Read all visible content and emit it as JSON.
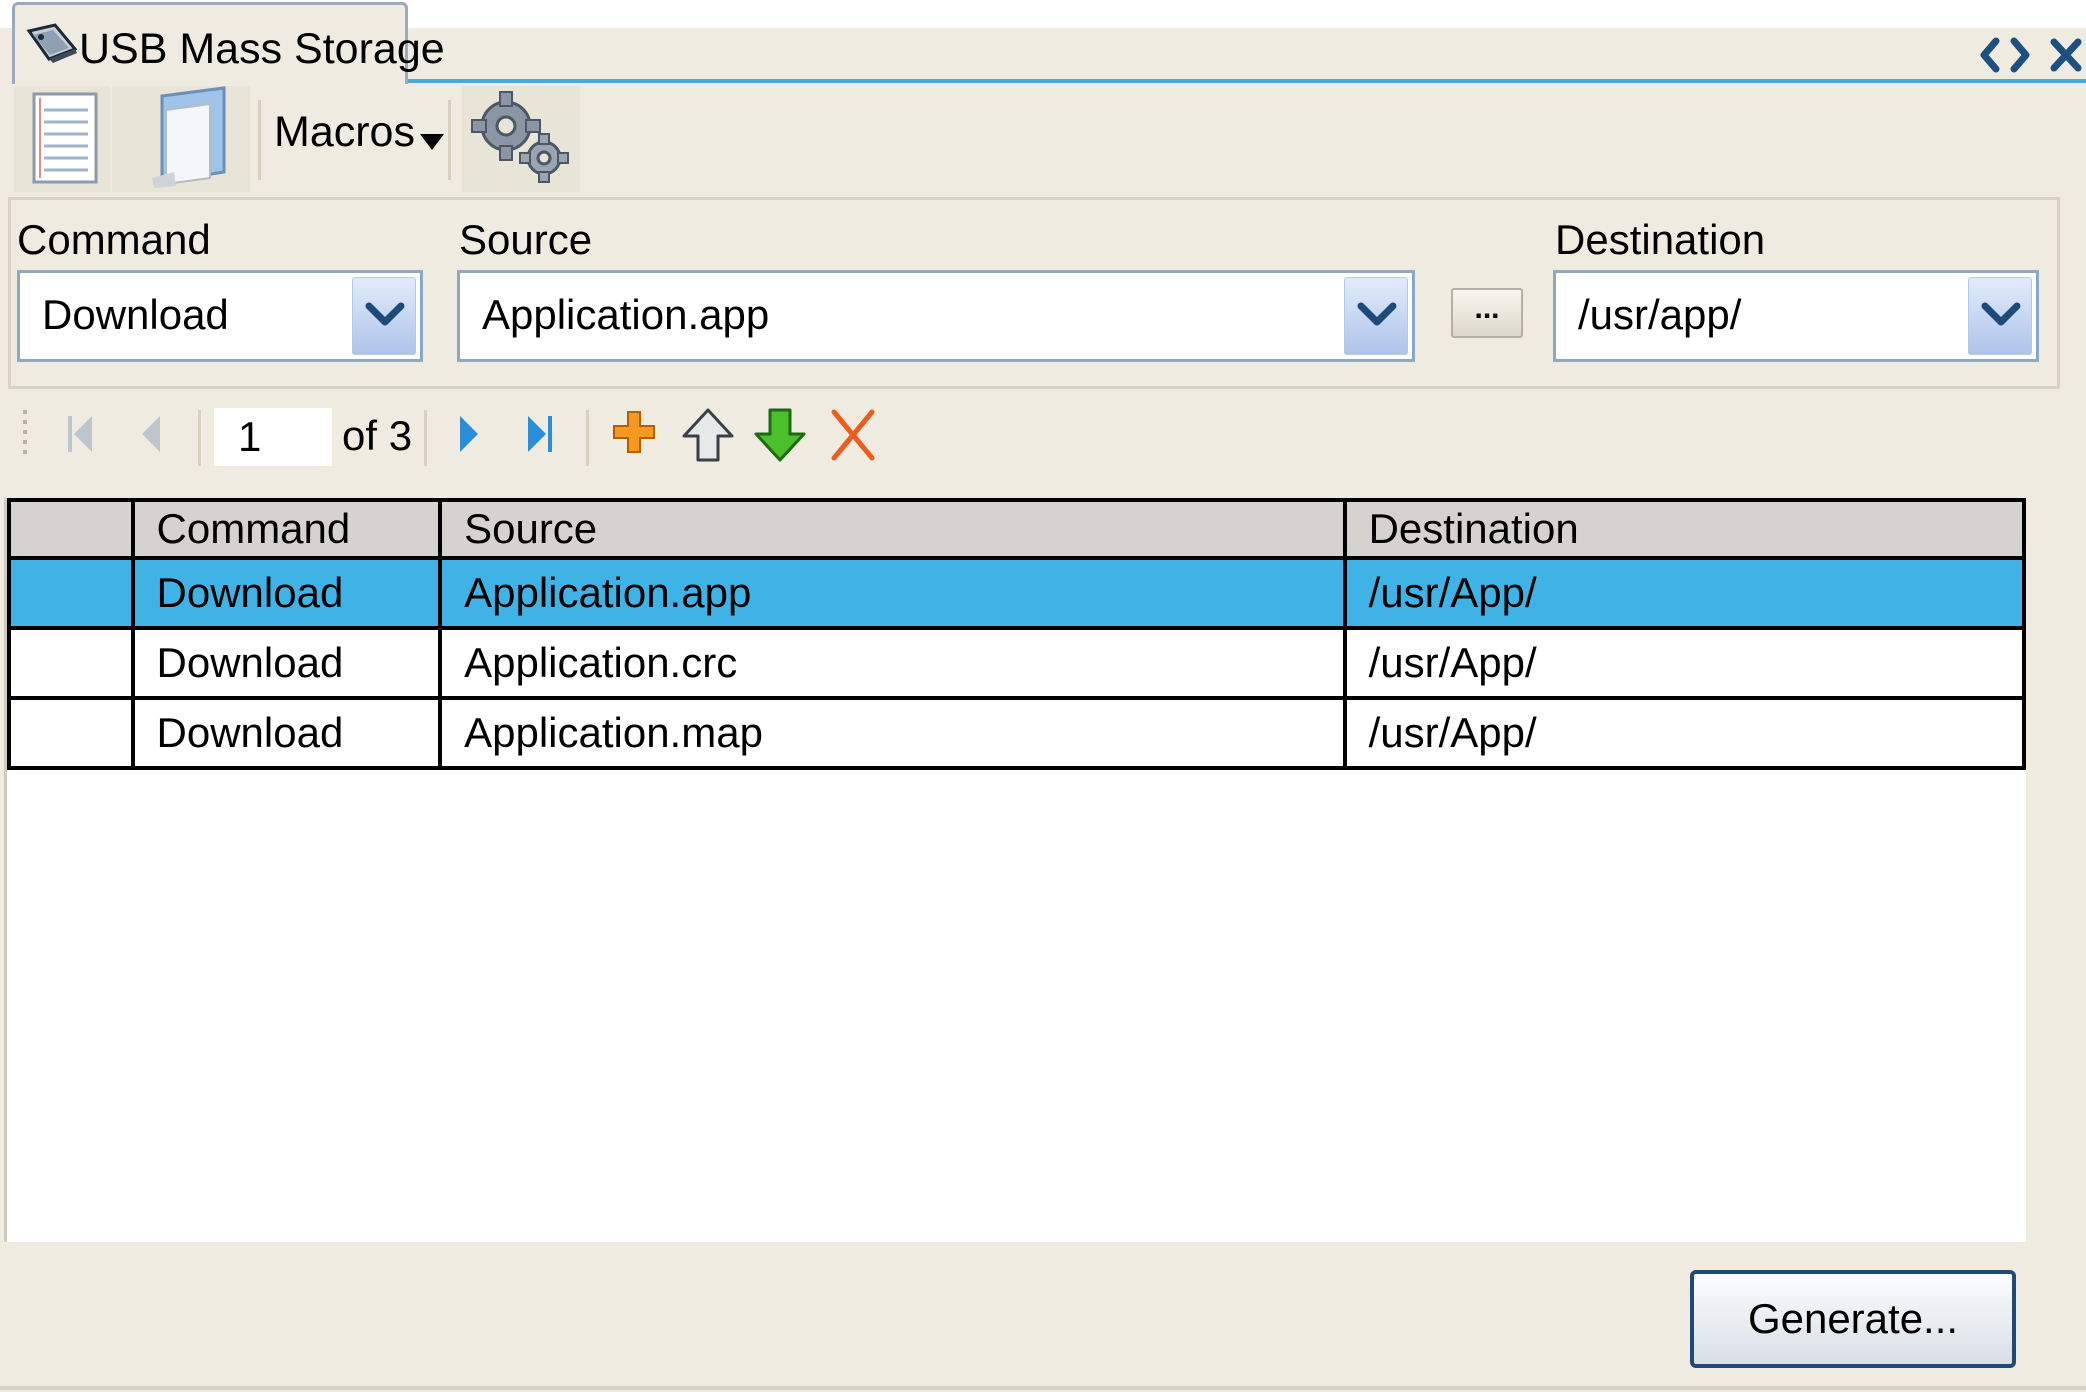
{
  "tab": {
    "title": "USB Mass Storage",
    "icon": "usb-drive-icon"
  },
  "window_controls": {
    "icons": [
      "expand-collapse-icon",
      "close-icon"
    ]
  },
  "toolbar": {
    "buttons": [
      "notepad-icon",
      "folder-icon",
      "macros-dropdown",
      "gears-icon"
    ],
    "macros_label": "Macros"
  },
  "form": {
    "command": {
      "label": "Command",
      "value": "Download"
    },
    "source": {
      "label": "Source",
      "value": "Application.app"
    },
    "browse_label": "...",
    "destination": {
      "label": "Destination",
      "value": "/usr/app/"
    }
  },
  "navigator": {
    "page": "1",
    "of_label": "of 3",
    "icons": [
      "first-page-icon",
      "previous-page-icon",
      "next-page-icon",
      "last-page-icon",
      "add-icon",
      "move-up-icon",
      "move-down-icon",
      "delete-icon"
    ]
  },
  "grid": {
    "columns": [
      "",
      "Command",
      "Source",
      "Destination"
    ],
    "rows": [
      {
        "command": "Download",
        "source": "Application.app",
        "destination": "/usr/App/",
        "selected": true
      },
      {
        "command": "Download",
        "source": "Application.crc",
        "destination": "/usr/App/",
        "selected": false
      },
      {
        "command": "Download",
        "source": "Application.map",
        "destination": "/usr/App/",
        "selected": false
      }
    ]
  },
  "generate_label": "Generate...",
  "colors": {
    "panel": "#efebe0",
    "selection": "#3fb3e6",
    "tab_line": "#4aa9d6",
    "button_border": "#1f4a78"
  }
}
